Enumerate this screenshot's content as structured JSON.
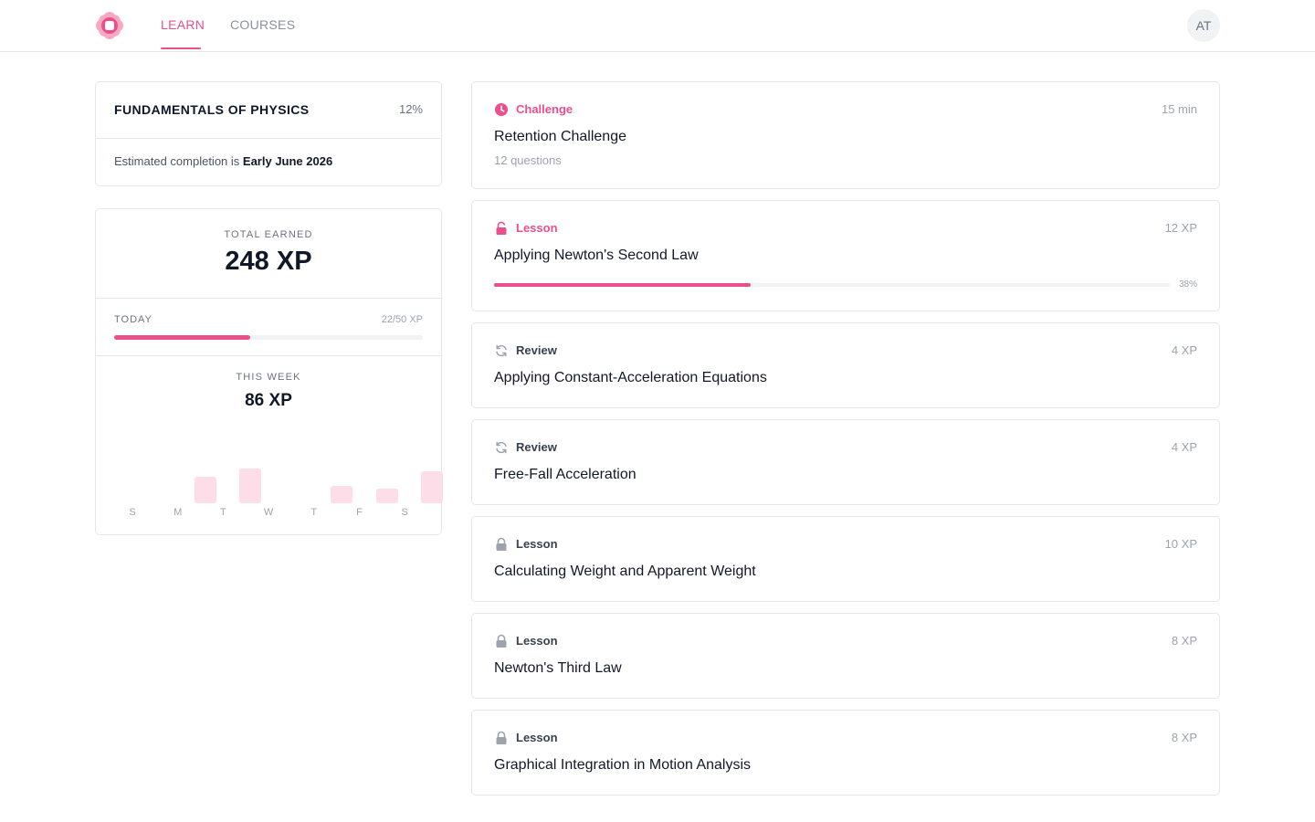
{
  "nav": {
    "tabs": [
      {
        "label": "LEARN",
        "active": true
      },
      {
        "label": "COURSES",
        "active": false
      }
    ],
    "avatar_initials": "AT",
    "accent_color": "#ec4f8b"
  },
  "course": {
    "title": "FUNDAMENTALS OF PHYSICS",
    "progress_label": "12%",
    "progress": 0.12,
    "estimate_prefix": "Estimated completion is",
    "estimate_date": "Early June 2026"
  },
  "xp": {
    "total_label": "TOTAL EARNED",
    "total": "248 XP",
    "today_label": "TODAY",
    "today_value": "22/50 XP",
    "today_progress": 0.44,
    "week_label": "THIS WEEK",
    "week_total": "86 XP",
    "week_chart": {
      "type": "bar",
      "categories": [
        "S",
        "M",
        "T",
        "W",
        "T",
        "F",
        "S"
      ],
      "values": [
        0,
        18,
        24,
        0,
        12,
        10,
        22
      ],
      "bar_color": "#fcdde8"
    }
  },
  "items": [
    {
      "type": "Challenge",
      "icon": "clock-icon",
      "accent": true,
      "meta": "15 min",
      "title": "Retention Challenge",
      "subtitle": "12 questions"
    },
    {
      "type": "Lesson",
      "icon": "unlocked-icon",
      "accent": true,
      "meta": "12 XP",
      "title": "Applying Newton's Second Law",
      "progress": 0.38,
      "progress_label": "38%"
    },
    {
      "type": "Review",
      "icon": "refresh-icon",
      "accent": false,
      "meta": "4 XP",
      "title": "Applying Constant-Acceleration Equations"
    },
    {
      "type": "Review",
      "icon": "refresh-icon",
      "accent": false,
      "meta": "4 XP",
      "title": "Free-Fall Acceleration"
    },
    {
      "type": "Lesson",
      "icon": "lock-icon",
      "accent": false,
      "meta": "10 XP",
      "title": "Calculating Weight and Apparent Weight"
    },
    {
      "type": "Lesson",
      "icon": "lock-icon",
      "accent": false,
      "meta": "8 XP",
      "title": "Newton's Third Law"
    },
    {
      "type": "Lesson",
      "icon": "lock-icon",
      "accent": false,
      "meta": "8 XP",
      "title": "Graphical Integration in Motion Analysis"
    }
  ]
}
